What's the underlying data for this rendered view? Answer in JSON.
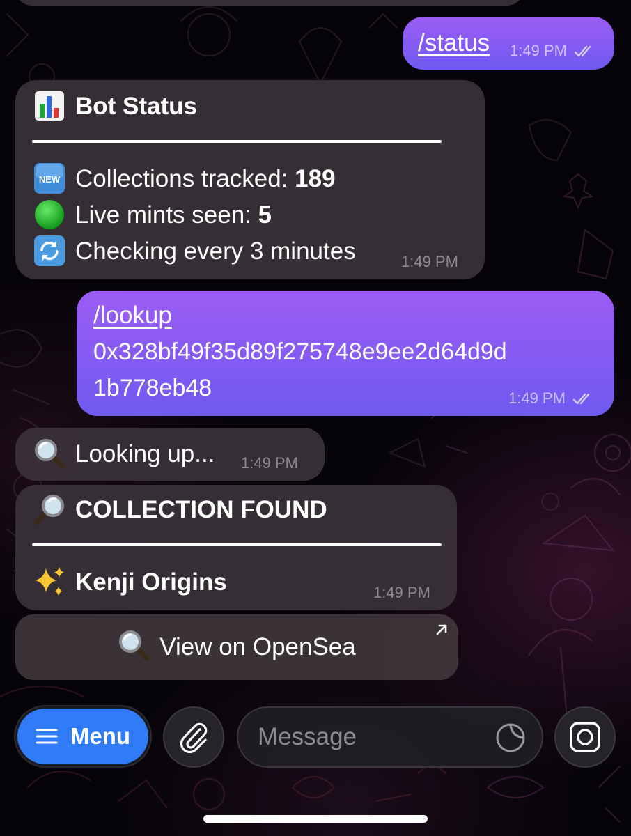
{
  "messages": {
    "status_cmd": {
      "text": "/status",
      "time": "1:49 PM"
    },
    "bot_status": {
      "title": "Bot Status",
      "collections_label": "Collections tracked: ",
      "collections_value": "189",
      "mints_label": "Live mints seen: ",
      "mints_value": "5",
      "checking_text": "Checking every 3 minutes",
      "time": "1:49 PM",
      "icons": [
        "bar-chart-icon",
        "new-badge-icon",
        "green-circle-icon",
        "refresh-icon"
      ]
    },
    "lookup_cmd": {
      "command": "/lookup",
      "address_line1": "0x328bf49f35d89f275748e9ee2d64d9d",
      "address_line2": "1b778eb48",
      "time": "1:49 PM"
    },
    "looking_up": {
      "text": "Looking up...",
      "time": "1:49 PM"
    },
    "collection_found": {
      "title": "COLLECTION FOUND",
      "name": "Kenji Origins",
      "time": "1:49 PM"
    }
  },
  "inline_button": {
    "label": "View on OpenSea"
  },
  "composer": {
    "menu_label": "Menu",
    "placeholder": "Message"
  },
  "colors": {
    "accent_blue": "#2f7cf6",
    "outgoing_bubble_top": "#9c5cf4",
    "outgoing_bubble_bottom": "#6f5af0",
    "incoming_bubble": "#3a323a"
  }
}
